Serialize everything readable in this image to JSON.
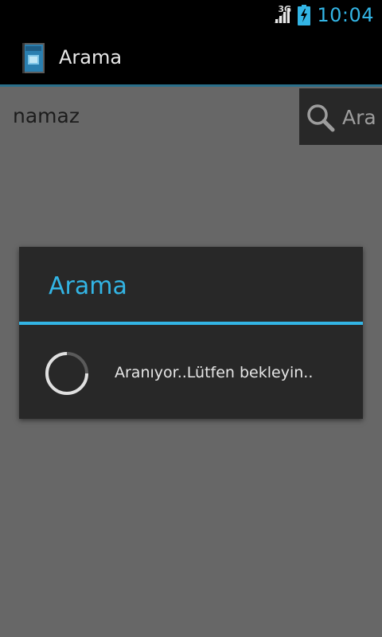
{
  "status_bar": {
    "network_type": "3G",
    "time": "10:04",
    "signal_icon": "signal-icon",
    "battery_icon": "battery-charging-icon"
  },
  "action_bar": {
    "title": "Arama",
    "app_icon": "app-book-icon"
  },
  "search": {
    "query": "namaz",
    "button_label": "Ara",
    "button_icon": "search-icon"
  },
  "dialog": {
    "title": "Arama",
    "message": "Aranıyor..Lütfen bekleyin..",
    "spinner_icon": "progress-spinner-icon"
  },
  "colors": {
    "accent": "#33b5e5",
    "background": "#676767",
    "dialog_bg": "#282828"
  }
}
